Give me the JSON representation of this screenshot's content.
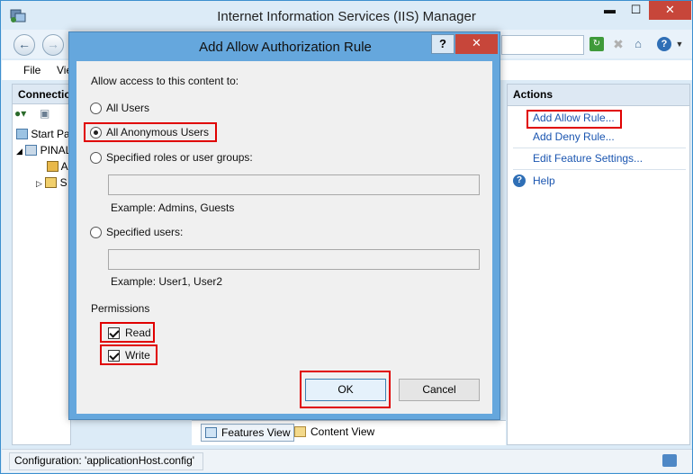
{
  "window": {
    "title": "Internet Information Services (IIS) Manager",
    "min_glyph": "▬",
    "max_glyph": "☐",
    "close_glyph": "✕"
  },
  "nav": {
    "back_glyph": "←",
    "forward_glyph": "→"
  },
  "menubar": {
    "file": "File",
    "view": "Vie"
  },
  "connections": {
    "header": "Connections",
    "tree": [
      {
        "label": "Start Page"
      },
      {
        "label": "PINAL"
      },
      {
        "label": "A"
      },
      {
        "label": "S"
      }
    ]
  },
  "actions": {
    "header": "Actions",
    "add_allow_rule": "Add Allow Rule...",
    "add_deny_rule": "Add Deny Rule...",
    "edit_feature_settings": "Edit Feature Settings...",
    "help": "Help"
  },
  "view_tabs": {
    "features_view": "Features View",
    "content_view": "Content View"
  },
  "status": {
    "configuration": "Configuration: 'applicationHost.config'"
  },
  "dialog": {
    "title": "Add Allow Authorization Rule",
    "help_glyph": "?",
    "close_glyph": "✕",
    "allow_access_label": "Allow access to this content to:",
    "options": {
      "all_users": "All Users",
      "all_anonymous_users": "All Anonymous Users",
      "specified_roles": "Specified roles or user groups:",
      "specified_users": "Specified users:"
    },
    "selected_option": "All Anonymous Users",
    "roles_value": "",
    "roles_example": "Example: Admins, Guests",
    "users_value": "",
    "users_example": "Example: User1, User2",
    "permissions_label": "Permissions",
    "read_label": "Read",
    "read_checked": true,
    "write_label": "Write",
    "write_checked": true,
    "ok_label": "OK",
    "cancel_label": "Cancel"
  },
  "colors": {
    "highlight": "#e00000",
    "link": "#1a55b0",
    "dialog_frame": "#65a7dd",
    "close_button": "#c7463a"
  }
}
